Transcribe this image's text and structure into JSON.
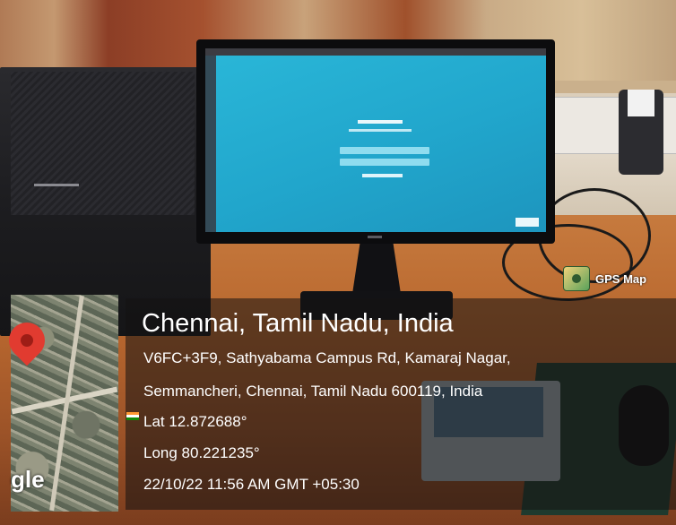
{
  "watermark": {
    "app_label": "GPS Map",
    "logo_icon": "gps-map-camera-logo"
  },
  "location": {
    "title": "Chennai, Tamil Nadu, India",
    "address_line1": "V6FC+3F9, Sathyabama Campus Rd, Kamaraj Nagar,",
    "address_line2": "Semmancheri, Chennai, Tamil Nadu 600119, India",
    "lat": "Lat 12.872688°",
    "long": "Long 80.221235°",
    "datetime": "22/10/22 11:56 AM GMT +05:30"
  },
  "map": {
    "provider_text": "gle",
    "pin_icon": "map-pin-icon",
    "pin_color": "#e13b30"
  },
  "colors": {
    "screen_accent": "#21a6cc",
    "overlay": "rgba(20,18,18,0.55)"
  }
}
